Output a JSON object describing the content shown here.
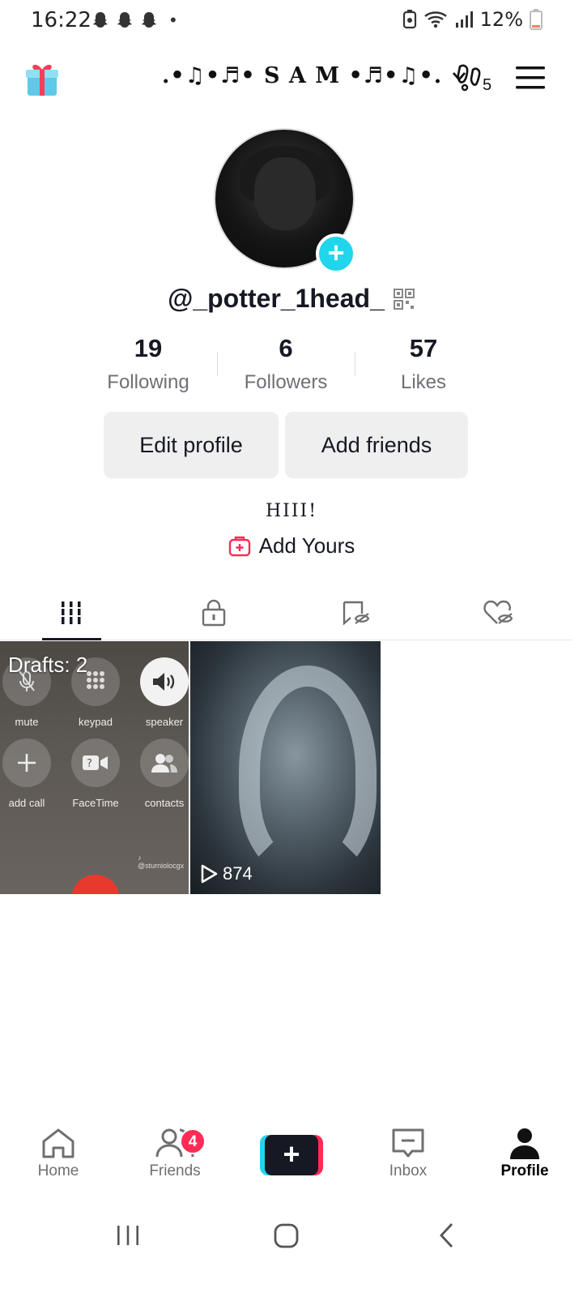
{
  "status_bar": {
    "time": "16:22",
    "dot": "•",
    "battery": "12%",
    "icons": [
      "snapchat-icon",
      "snapchat-icon",
      "snapchat-icon",
      "dot-icon",
      "battery-saver-icon",
      "wifi-icon",
      "signal-icon",
      "battery-icon"
    ]
  },
  "header": {
    "title": ".•♫•♬• S A M •♬•♫•.",
    "creator_count": "5"
  },
  "profile": {
    "username": "@_potter_1head_",
    "stats": [
      {
        "value": "19",
        "label": "Following"
      },
      {
        "value": "6",
        "label": "Followers"
      },
      {
        "value": "57",
        "label": "Likes"
      }
    ],
    "edit_profile": "Edit profile",
    "add_friends": "Add friends",
    "bio": "HIII!",
    "add_yours": "Add Yours"
  },
  "tabs": [
    "videos-grid-icon",
    "private-lock-icon",
    "reposts-hidden-icon",
    "liked-hidden-icon"
  ],
  "grid": {
    "draft": {
      "label": "Drafts: 2",
      "controls": [
        "mute",
        "keypad",
        "speaker",
        "add call",
        "FaceTime",
        "contacts"
      ],
      "watermark": "♪ @sturniolocgx"
    },
    "video": {
      "views": "874"
    }
  },
  "bottom_nav": [
    {
      "label": "Home",
      "icon": "home-icon"
    },
    {
      "label": "Friends",
      "icon": "friends-icon",
      "badge": "4"
    },
    {
      "label": "",
      "icon": "create-plus-icon"
    },
    {
      "label": "Inbox",
      "icon": "inbox-icon"
    },
    {
      "label": "Profile",
      "icon": "profile-icon"
    }
  ],
  "colors": {
    "accent_cyan": "#20d5ec",
    "accent_pink": "#fe2c55",
    "text": "#161823",
    "muted": "#6f7076",
    "button_bg": "#efefef"
  }
}
